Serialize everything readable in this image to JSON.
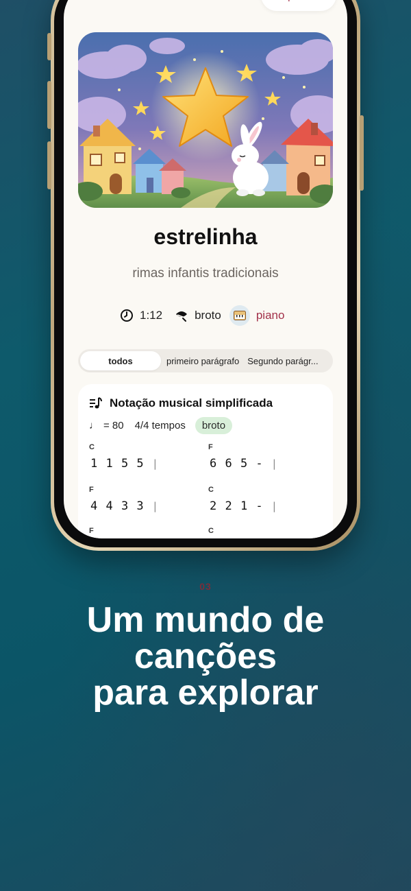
{
  "top": {
    "partial_title": "— — — — —",
    "partial_button": "— p"
  },
  "song": {
    "title": "estrelinha",
    "subtitle": "rimas infantis tradicionais",
    "duration": "1:12",
    "level": "broto",
    "instrument": "piano",
    "clock_icon": "clock-icon",
    "level_icon": "leaf-icon",
    "instrument_icon": "piano-icon"
  },
  "tabs": [
    {
      "label": "todos",
      "active": true
    },
    {
      "label": "primeiro parágrafo",
      "active": false
    },
    {
      "label": "Segundo parágr...",
      "active": false
    }
  ],
  "notation": {
    "title": "Notação musical simplificada",
    "tempo_symbol": "♩",
    "tempo": "= 80",
    "time_signature": "4/4 tempos",
    "level_badge": "broto",
    "measures": [
      {
        "chord": "C",
        "notes": "1 1 5 5"
      },
      {
        "chord": "F",
        "notes": "6 6 5 -"
      },
      {
        "chord": "F",
        "notes": "4 4 3 3"
      },
      {
        "chord": "C",
        "notes": "2 2 1 -"
      },
      {
        "chord": "F",
        "notes": ""
      },
      {
        "chord": "C",
        "notes": ""
      }
    ]
  },
  "promo": {
    "step": "03",
    "headline_lines": [
      "Um mundo de",
      "canções",
      "para explorar"
    ]
  },
  "colors": {
    "accent": "#a3314a",
    "level_badge_bg": "#d8efd9",
    "background": "#0e5a6b",
    "phone_frame": "#c9b48c"
  }
}
